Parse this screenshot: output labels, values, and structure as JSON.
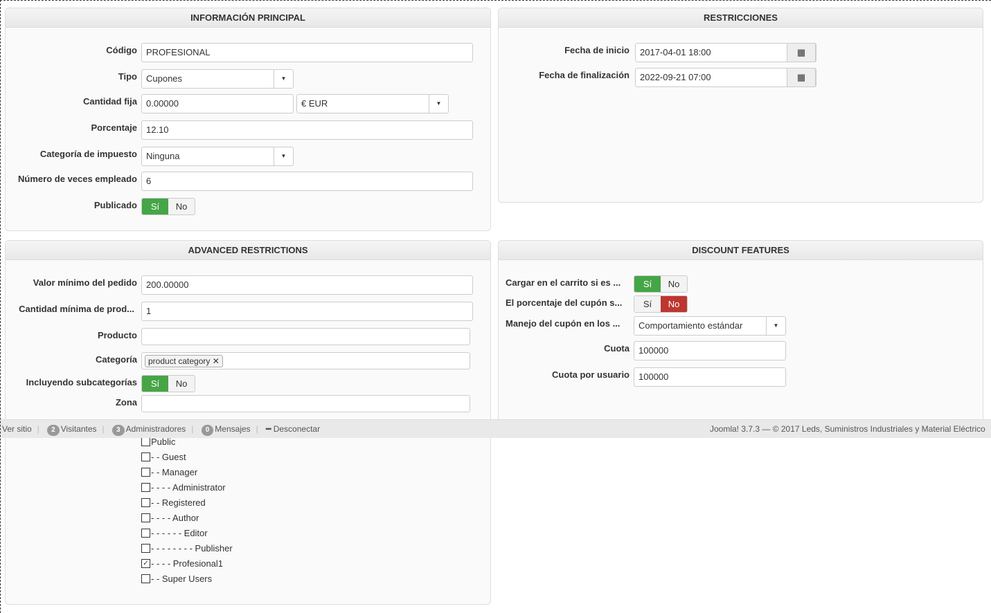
{
  "main": {
    "title": "INFORMACIÓN PRINCIPAL",
    "codigo_label": "Código",
    "codigo": "PROFESIONAL",
    "tipo_label": "Tipo",
    "tipo": "Cupones",
    "cantidad_label": "Cantidad fija",
    "cantidad": "0.00000",
    "currency": "€ EUR",
    "porcentaje_label": "Porcentaje",
    "porcentaje": "12.10",
    "impuesto_label": "Categoría de impuesto",
    "impuesto": "Ninguna",
    "veces_label": "Número de veces empleado",
    "veces": "6",
    "publicado_label": "Publicado",
    "yes": "Sí",
    "no": "No"
  },
  "restr": {
    "title": "RESTRICCIONES",
    "inicio_label": "Fecha de inicio",
    "inicio": "2017-04-01 18:00",
    "fin_label": "Fecha de finalización",
    "fin": "2022-09-21 07:00"
  },
  "adv": {
    "title": "ADVANCED RESTRICTIONS",
    "min_label": "Valor mínimo del pedido",
    "min": "200.00000",
    "cant_label": "Cantidad mínima de prod...",
    "cant": "1",
    "producto_label": "Producto",
    "categoria_label": "Categoría",
    "category_tag": "product category",
    "sub_label": "Incluyendo subcategorías",
    "zona_label": "Zona",
    "yes": "Sí",
    "no": "No",
    "groups": [
      {
        "label": "Public",
        "checked": false
      },
      {
        "label": "- - Guest",
        "checked": false
      },
      {
        "label": "- - Manager",
        "checked": false
      },
      {
        "label": "- - - - Administrator",
        "checked": false
      },
      {
        "label": "- - Registered",
        "checked": false
      },
      {
        "label": "- - - - Author",
        "checked": false
      },
      {
        "label": "- - - - - - Editor",
        "checked": false
      },
      {
        "label": "- - - - - - - - Publisher",
        "checked": false
      },
      {
        "label": "- - - - Profesional1",
        "checked": true
      },
      {
        "label": "- - Super Users",
        "checked": false
      }
    ]
  },
  "disc": {
    "title": "DISCOUNT FEATURES",
    "cargar_label": "Cargar en el carrito si es ...",
    "porc_label": "El porcentaje del cupón s...",
    "manejo_label": "Manejo del cupón en los ...",
    "manejo": "Comportamiento estándar",
    "cuota_label": "Cuota",
    "cuota": "100000",
    "cuota_usr_label": "Cuota por usuario",
    "cuota_usr": "100000",
    "yes": "Sí",
    "no": "No"
  },
  "status": {
    "ver_sitio": "Ver sitio",
    "visitantes_count": "2",
    "visitantes": "Visitantes",
    "admins_count": "3",
    "admins": "Administradores",
    "mensajes_count": "0",
    "mensajes": "Mensajes",
    "desconectar": "Desconectar",
    "footer": "Joomla! 3.7.3 — © 2017 Leds, Suministros Industriales y Material Eléctrico"
  }
}
